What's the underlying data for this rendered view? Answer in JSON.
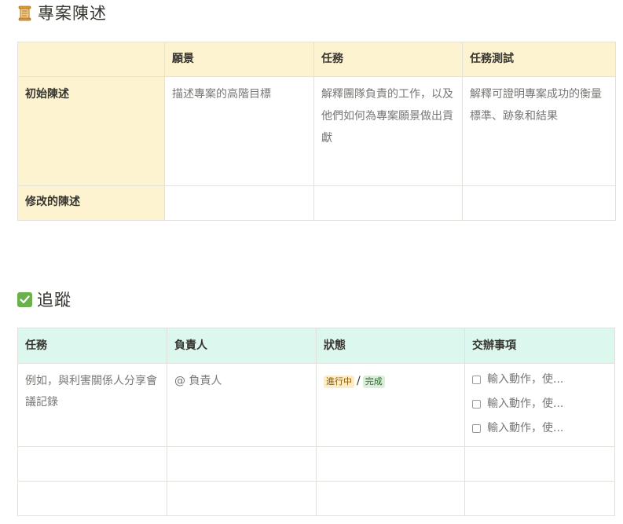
{
  "section1": {
    "title": "專案陳述",
    "icon": "scroll-icon",
    "columns": [
      "",
      "願景",
      "任務",
      "任務測試"
    ],
    "rows": [
      {
        "label": "初始陳述",
        "cells": [
          "描述專案的高階目標",
          "解釋團隊負責的工作，以及他們如何為專案願景做出貢獻",
          "解釋可證明專案成功的衡量標準、跡象和結果"
        ]
      },
      {
        "label": "修改的陳述",
        "cells": [
          "",
          "",
          ""
        ]
      }
    ]
  },
  "section2": {
    "title": "追蹤",
    "icon": "check-icon",
    "columns": [
      "任務",
      "負責人",
      "狀態",
      "交辦事項"
    ],
    "row": {
      "task": "例如，與利害關係人分享會議記錄",
      "owner": "@ 負責人",
      "status_in_progress": "進行中",
      "status_separator": "/",
      "status_done": "完成",
      "todos": [
        "輸入動作，使...",
        "輸入動作，使...",
        "輸入動作，使..."
      ]
    }
  },
  "colors": {
    "header_yellow": "#fdf3d1",
    "header_green": "#dcf7ed",
    "check_green": "#6ab04c"
  }
}
